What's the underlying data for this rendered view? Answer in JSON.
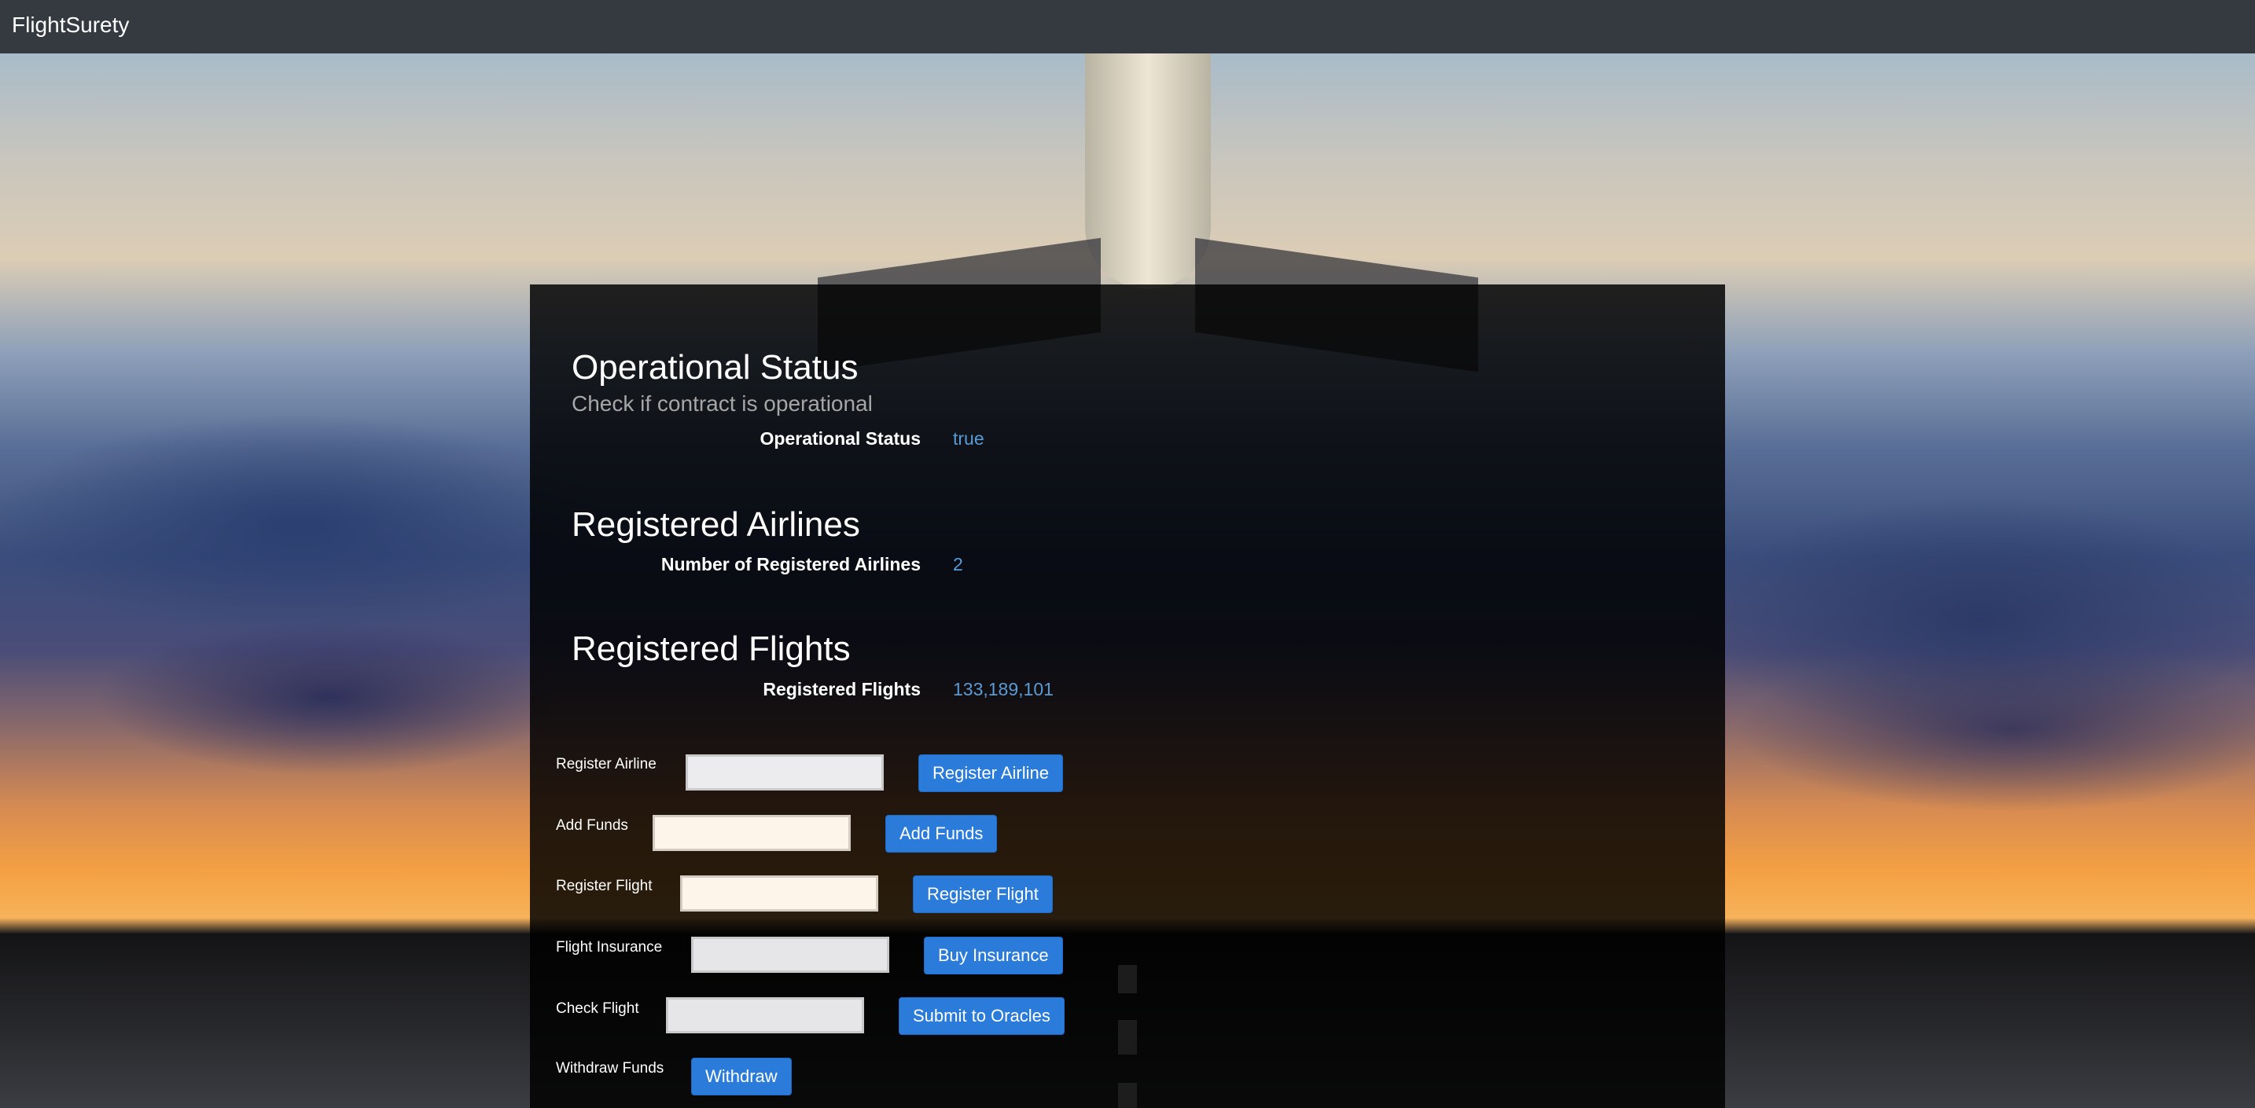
{
  "navbar": {
    "brand": "FlightSurety"
  },
  "operational": {
    "title": "Operational Status",
    "subtitle": "Check if contract is operational",
    "label": "Operational Status",
    "value": "true"
  },
  "airlines": {
    "title": "Registered Airlines",
    "label": "Number of Registered Airlines",
    "value": "2"
  },
  "flights": {
    "title": "Registered Flights",
    "label": "Registered Flights",
    "value": "133,189,101"
  },
  "forms": {
    "register_airline": {
      "label": "Register Airline",
      "button": "Register Airline",
      "value": ""
    },
    "add_funds": {
      "label": "Add Funds",
      "button": "Add Funds",
      "value": ""
    },
    "register_flight": {
      "label": "Register Flight",
      "button": "Register Flight",
      "value": ""
    },
    "flight_insurance": {
      "label": "Flight Insurance",
      "button": "Buy Insurance",
      "value": ""
    },
    "check_flight": {
      "label": "Check Flight",
      "button": "Submit to Oracles",
      "value": ""
    },
    "withdraw_funds": {
      "label": "Withdraw Funds",
      "button": "Withdraw"
    }
  },
  "colors": {
    "navbar": "#343a40",
    "accent": "#2b7bdb",
    "value_text": "#5a9bd5"
  }
}
